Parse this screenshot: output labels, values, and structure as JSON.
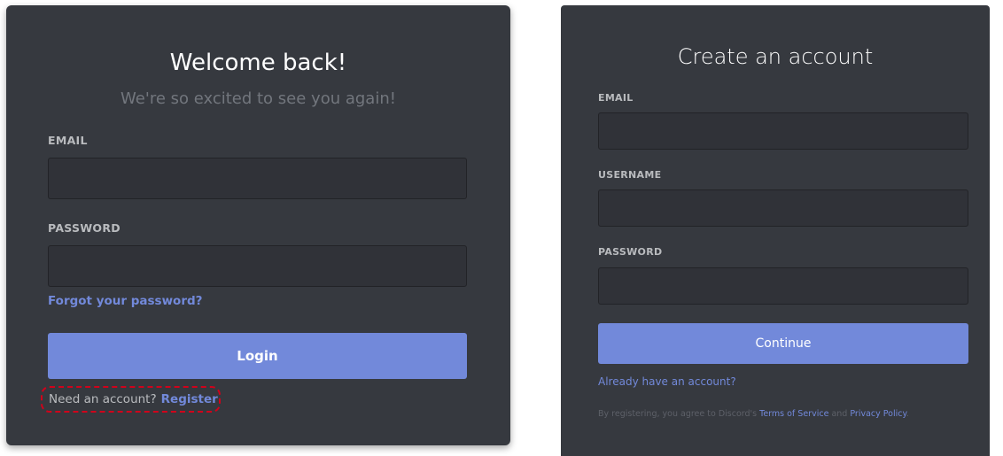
{
  "login": {
    "title": "Welcome back!",
    "subtitle": "We're so excited to see you again!",
    "email_label": "EMAIL",
    "email_value": "",
    "password_label": "PASSWORD",
    "password_value": "",
    "forgot_link": "Forgot your password?",
    "login_button": "Login",
    "need_account_text": "Need an account?",
    "register_link": "Register",
    "highlight_color": "#d0021b"
  },
  "register": {
    "title": "Create an account",
    "email_label": "EMAIL",
    "email_value": "",
    "username_label": "USERNAME",
    "username_value": "",
    "password_label": "PASSWORD",
    "password_value": "",
    "continue_button": "Continue",
    "already_link": "Already have an account?",
    "tos_prefix": "By registering, you agree to Discord's",
    "tos_link": "Terms of Service",
    "tos_and": "and",
    "privacy_link": "Privacy Policy",
    "tos_suffix": "."
  },
  "colors": {
    "background": "#36393f",
    "accent": "#7289da",
    "input_bg": "#303238",
    "label": "#b9bbbe"
  }
}
